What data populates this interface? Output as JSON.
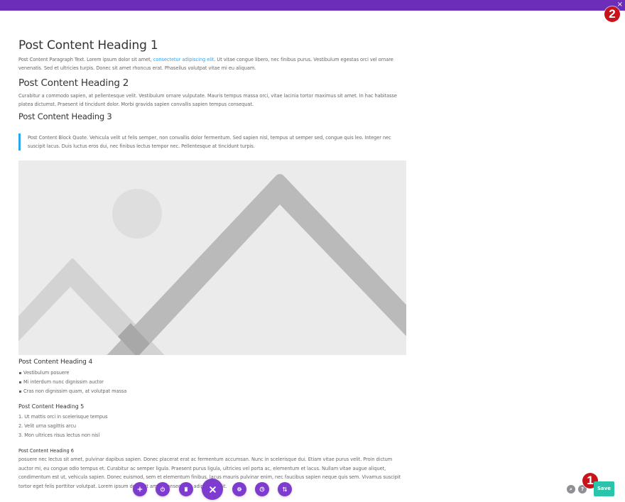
{
  "topbar": {
    "color": "#6c2eb9",
    "close_glyph": "×"
  },
  "annotations": {
    "badge_1": "1",
    "badge_2": "2"
  },
  "post": {
    "heading_1": "Post Content Heading 1",
    "paragraph_1_before_link": "Post Content Paragraph Text. Lorem ipsum dolor sit amet, ",
    "paragraph_1_link": "consectetur adipiscing elit",
    "paragraph_1_after_link": ". Ut vitae congue libero, nec finibus purus. Vestibulum egestas orci vel ornare venenatis. Sed et ultricies turpis. Donec sit amet rhoncus erat. Phasellus volutpat vitae mi eu aliquam.",
    "heading_2": "Post Content Heading 2",
    "paragraph_2": "Curabitur a commodo sapien, at pellentesque velit. Vestibulum ornare vulputate. Mauris tempus massa orci, vitae lacinia tortor maximus sit amet. In hac habitasse platea dictumst. Praesent id tincidunt dolor. Morbi gravida sapien convallis sapien tempus consequat.",
    "heading_3": "Post Content Heading 3",
    "blockquote": "Post Content Block Quote. Vehicula velit ut felis semper, non convallis dolor fermentum. Sed sapien nisl, tempus ut semper sed, congue quis leo. Integer nec suscipit lacus. Duis luctus eros dui, nec finibus lectus tempor nec. Pellentesque at tincidunt turpis.",
    "image_alt": "placeholder image",
    "heading_4": "Post Content Heading 4",
    "bullet_list": [
      "Vestibulum posuere",
      "Mi interdum nunc dignissim auctor",
      "Cras non dignissim quam, at volutpat massa"
    ],
    "heading_5": "Post Content Heading 5",
    "ordered_list": [
      "1. Ut mattis orci in scelerisque tempus",
      "2. Velit urna sagittis arcu",
      "3. Mon ultrices risus lectus non nisl"
    ],
    "heading_6": "Post Content Heading 6",
    "paragraph_6": "posuere nec lectus sit amet, pulvinar dapibus sapien. Donec placerat erat ac fermentum accumsan. Nunc in scelerisque dui. Etiam vitae purus velit. Proin dictum auctor mi, eu congue odio tempus et. Curabitur ac semper ligula. Praesent purus ligula, ultricies vel porta ac, elementum et lacus. Nullam vitae augue aliquet, condimentum est ut, vehicula sapien. Donec euismod, sem et elementum finibus, lacus mauris pulvinar enim, nec faucibus sapien neque quis sem. Vivamus suscipit tortor eget felis porttitor volutpat. Lorem ipsum dolor sit amet, consectetur adipiscing elit."
  },
  "toolbar": {
    "buttons": [
      {
        "name": "add",
        "icon": "plus-icon"
      },
      {
        "name": "power",
        "icon": "power-icon"
      },
      {
        "name": "trash",
        "icon": "trash-icon"
      },
      {
        "name": "close",
        "icon": "close-icon"
      },
      {
        "name": "settings",
        "icon": "gear-icon"
      },
      {
        "name": "history",
        "icon": "clock-icon"
      },
      {
        "name": "portability",
        "icon": "sort-arrows-icon"
      }
    ],
    "accent": "#7e3bd0"
  },
  "bottom_right": {
    "zoom_glyph": "⌕",
    "help_glyph": "?",
    "save_label": "Save",
    "save_color": "#29c4a9"
  }
}
